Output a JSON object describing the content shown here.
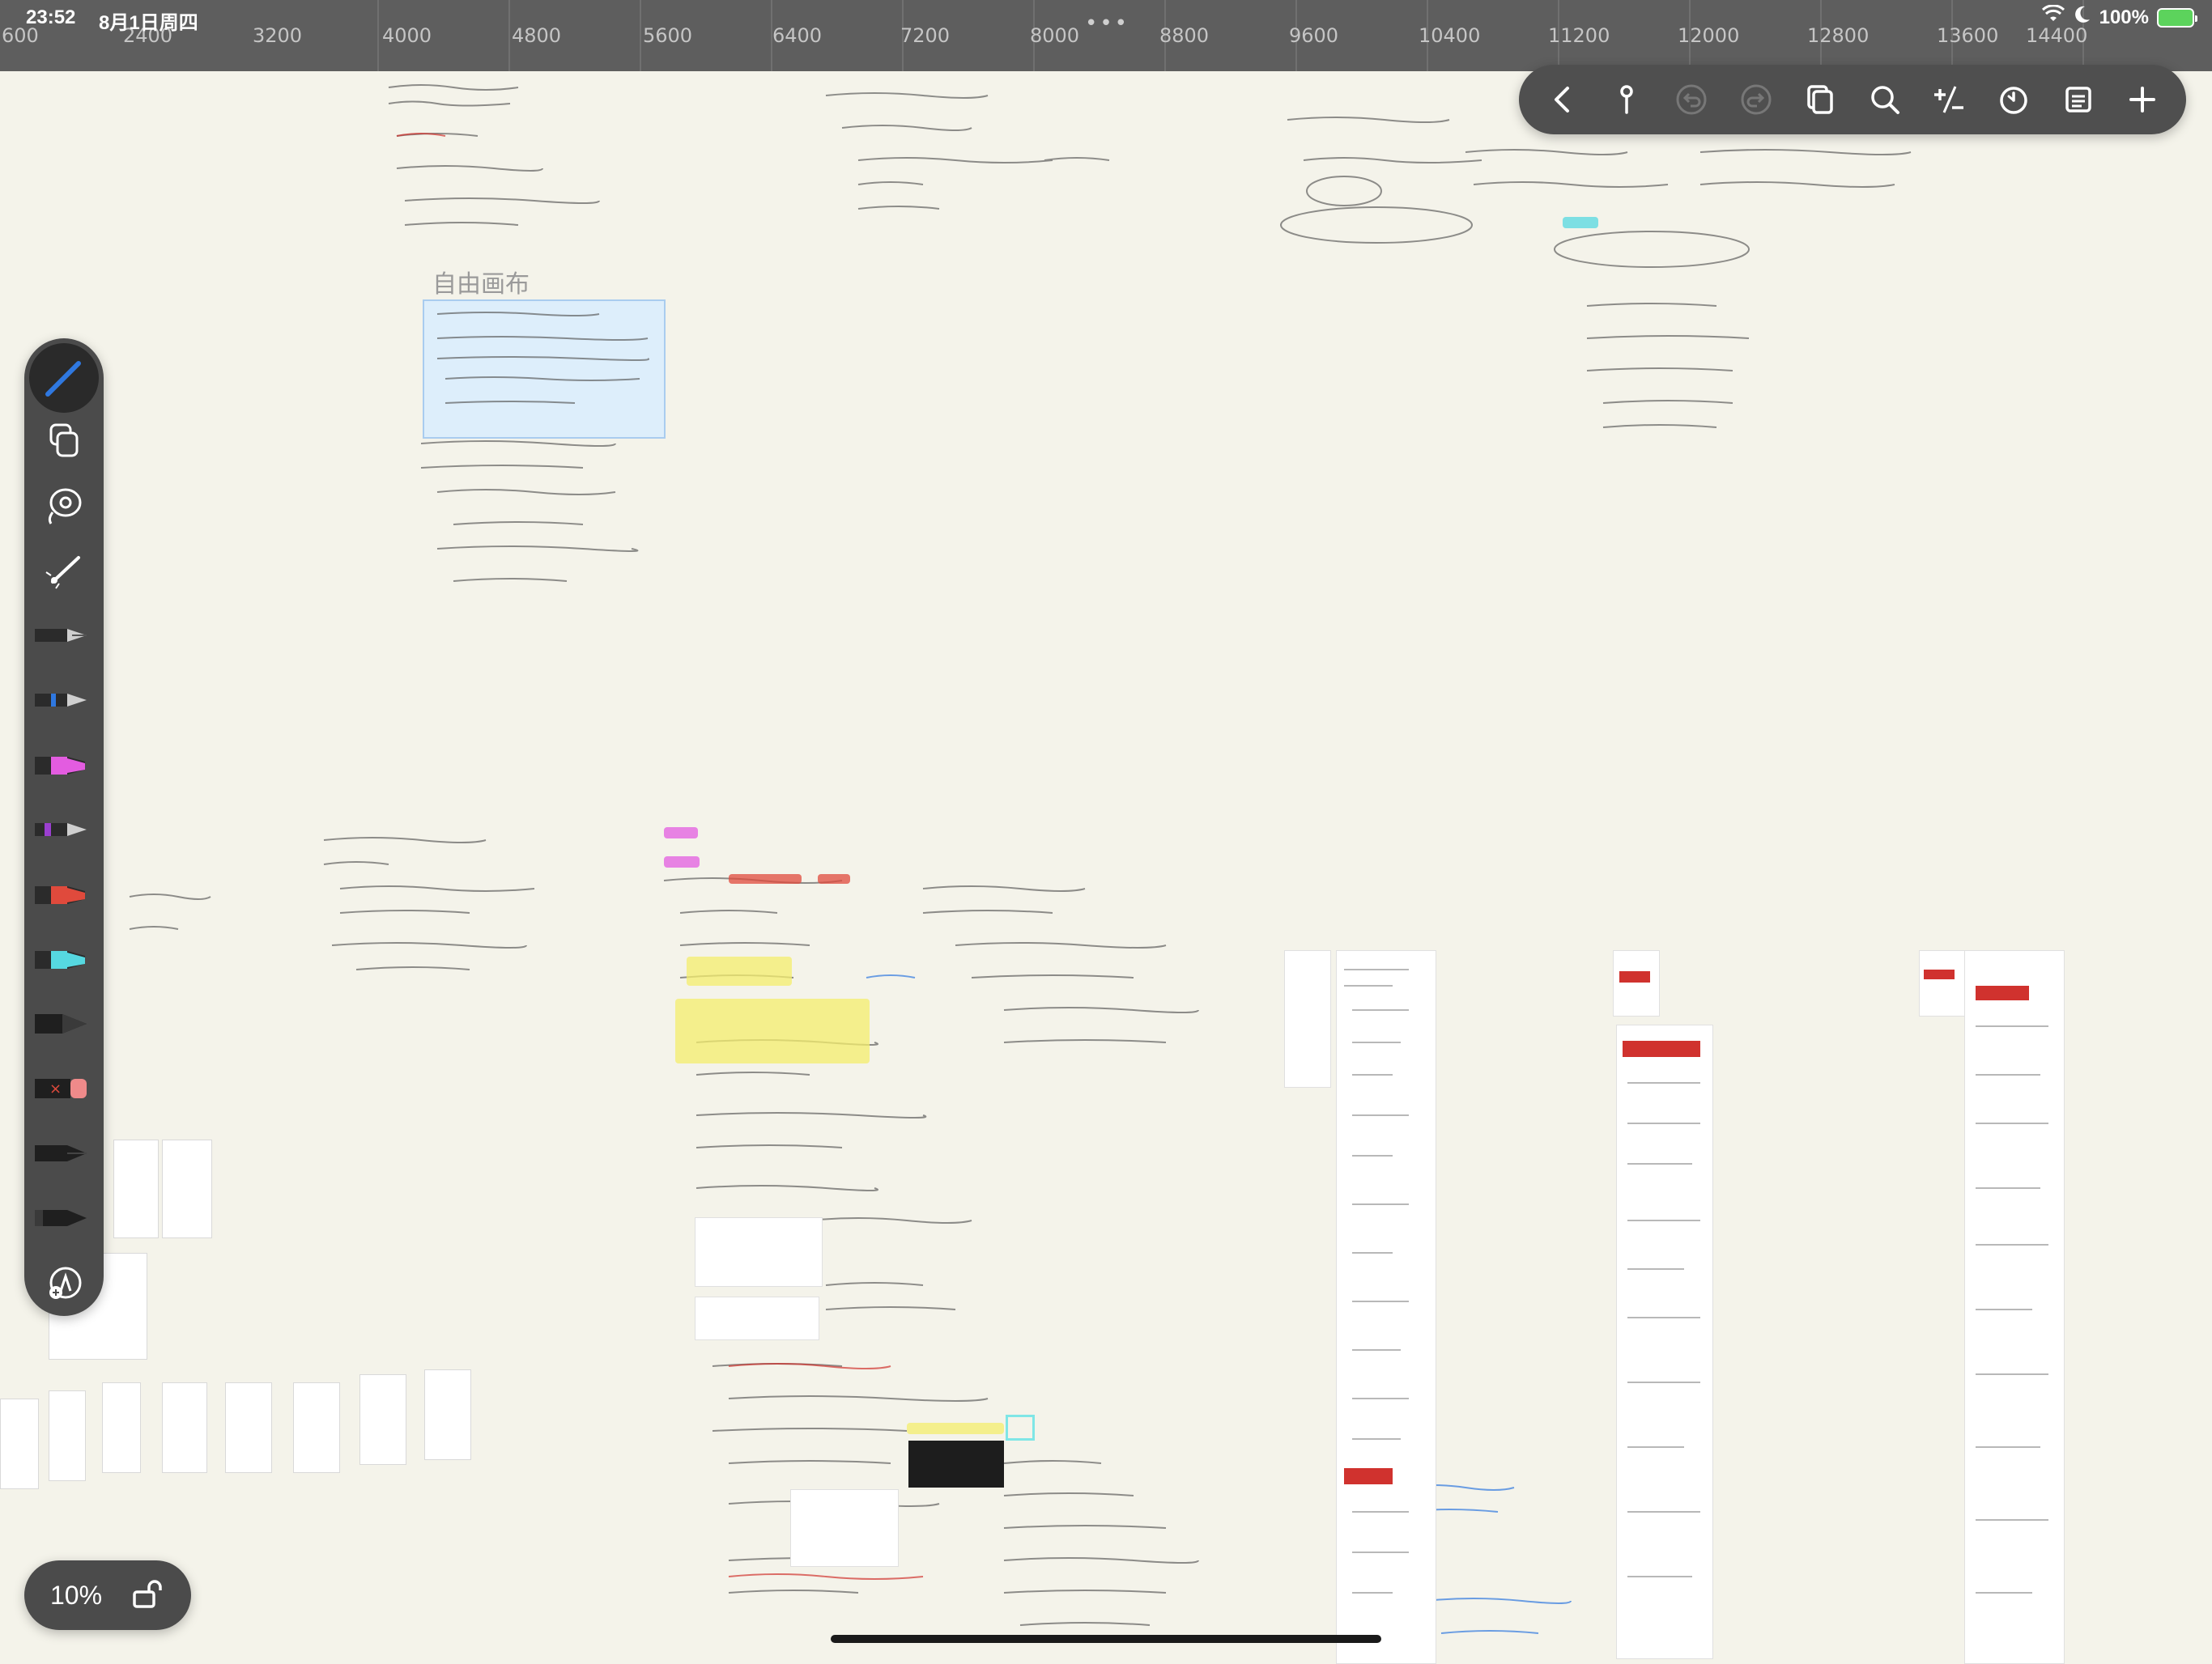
{
  "status_bar": {
    "time": "23:52",
    "date": "8月1日周四",
    "battery": "100%"
  },
  "ruler": {
    "ticks": [
      "600",
      "2400",
      "3200",
      "4000",
      "4800",
      "5600",
      "6400",
      "7200",
      "8000",
      "8800",
      "9600",
      "10400",
      "11200",
      "12000",
      "12800",
      "13600",
      "14400"
    ]
  },
  "toolbar": {
    "buttons": [
      "back-icon",
      "pin-icon",
      "undo-icon",
      "redo-icon",
      "pages-icon",
      "search-icon",
      "plus-minus-icon",
      "timer-icon",
      "notes-icon",
      "add-icon"
    ]
  },
  "canvas": {
    "free_draw_label": "自由画布"
  },
  "zoom": {
    "level": "10%"
  },
  "colors": {
    "accent_pen": "#2f78e0",
    "highlighter_pink": "#e35ce0",
    "highlighter_red": "#e04a3c",
    "highlighter_cyan": "#56d8e0",
    "highlight_yellow": "#f4ee6c"
  }
}
